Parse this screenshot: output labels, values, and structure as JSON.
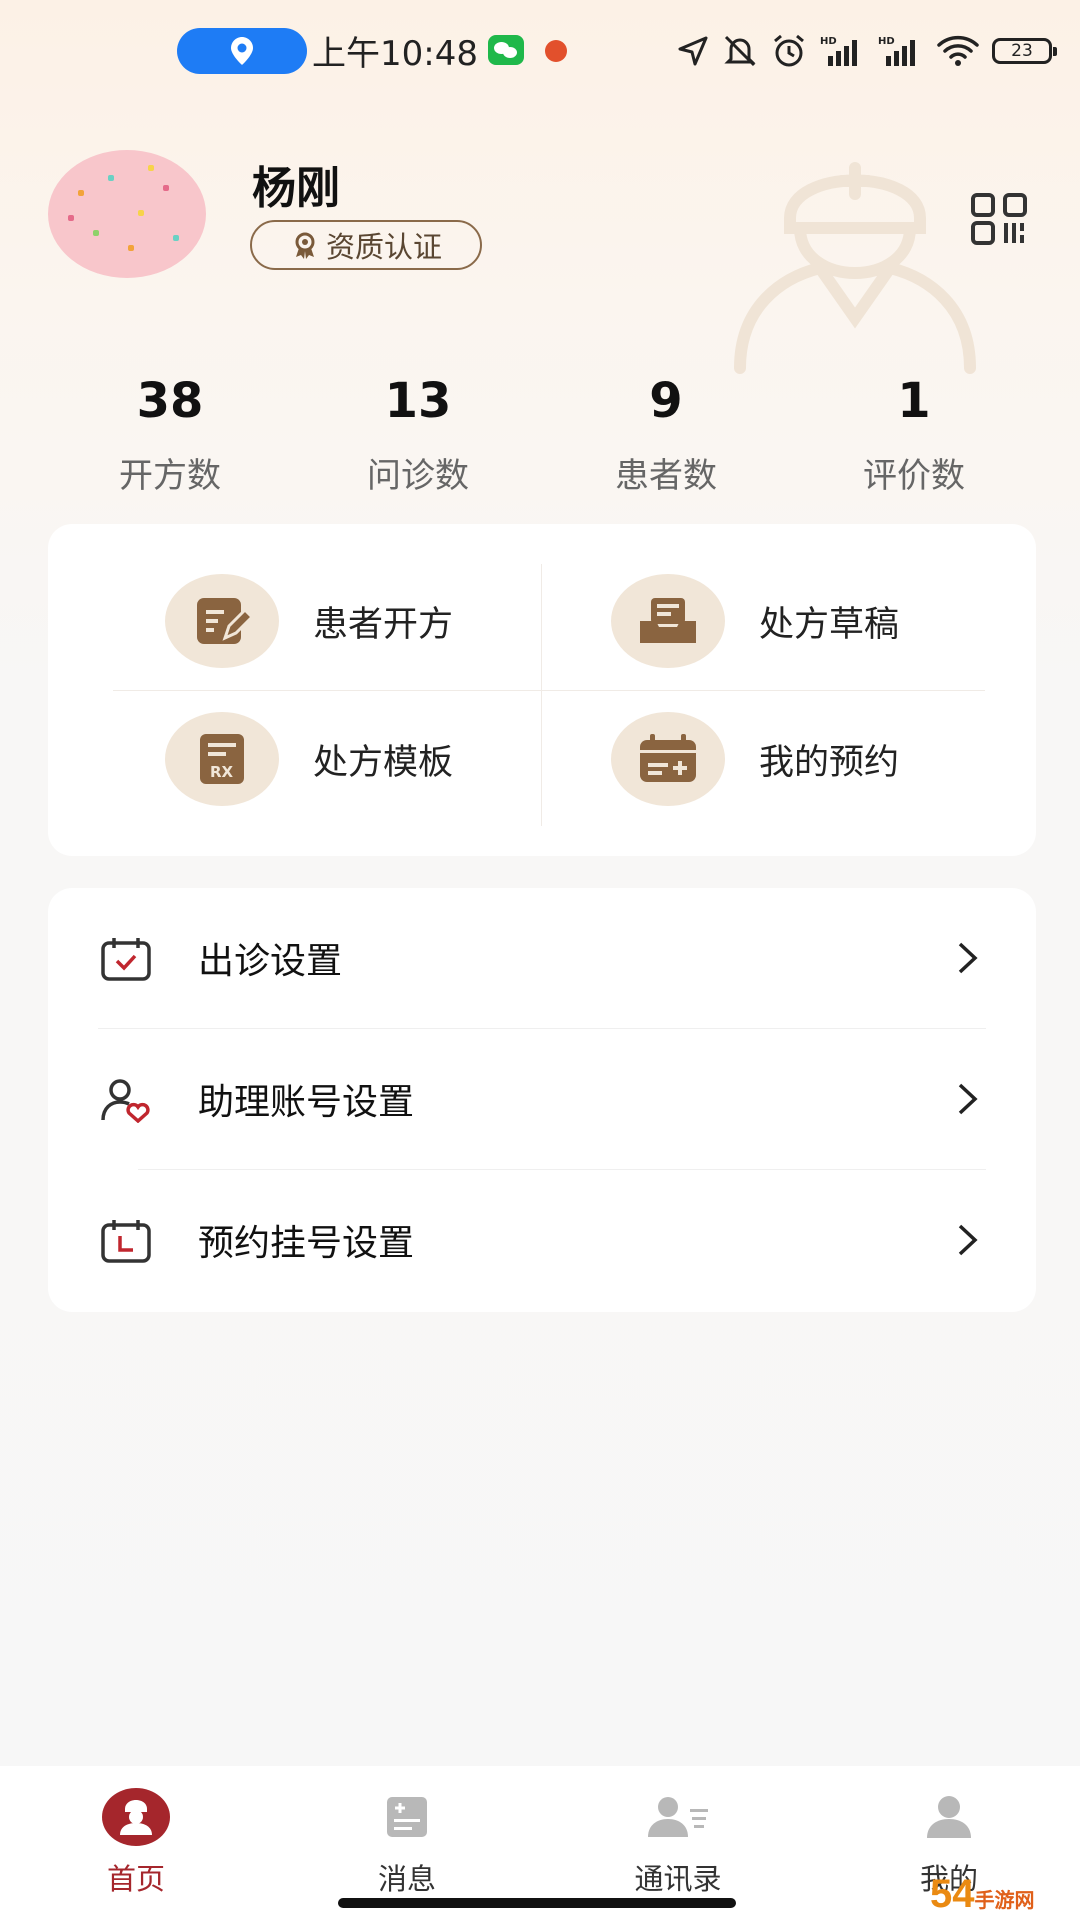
{
  "status_bar": {
    "time": "上午10:48",
    "battery": "23",
    "icons": [
      "location-icon",
      "wechat-icon",
      "app-icon",
      "navigation-icon",
      "mute-icon",
      "alarm-icon",
      "signal-hd-icon",
      "signal-hd-icon",
      "wifi-icon",
      "battery-icon"
    ]
  },
  "profile": {
    "name": "杨刚",
    "cert_label": "资质认证"
  },
  "stats": [
    {
      "value": "38",
      "label": "开方数"
    },
    {
      "value": "13",
      "label": "问诊数"
    },
    {
      "value": "9",
      "label": "患者数"
    },
    {
      "value": "1",
      "label": "评价数"
    }
  ],
  "functions": [
    {
      "label": "患者开方",
      "icon": "prescribe-icon"
    },
    {
      "label": "处方草稿",
      "icon": "draft-icon"
    },
    {
      "label": "处方模板",
      "icon": "template-icon"
    },
    {
      "label": "我的预约",
      "icon": "appointment-icon"
    }
  ],
  "settings": [
    {
      "label": "出诊设置",
      "icon": "calendar-check-icon"
    },
    {
      "label": "助理账号设置",
      "icon": "assistant-icon"
    },
    {
      "label": "预约挂号设置",
      "icon": "calendar-clock-icon"
    }
  ],
  "tabs": [
    {
      "label": "首页",
      "active": true
    },
    {
      "label": "消息",
      "active": false
    },
    {
      "label": "通讯录",
      "active": false
    },
    {
      "label": "我的",
      "active": false
    }
  ],
  "colors": {
    "accent": "#a5262c",
    "brown": "#8a6440",
    "icon_bg": "#f1e6d8"
  },
  "watermark": {
    "text": "54",
    "domain": "手游网"
  }
}
